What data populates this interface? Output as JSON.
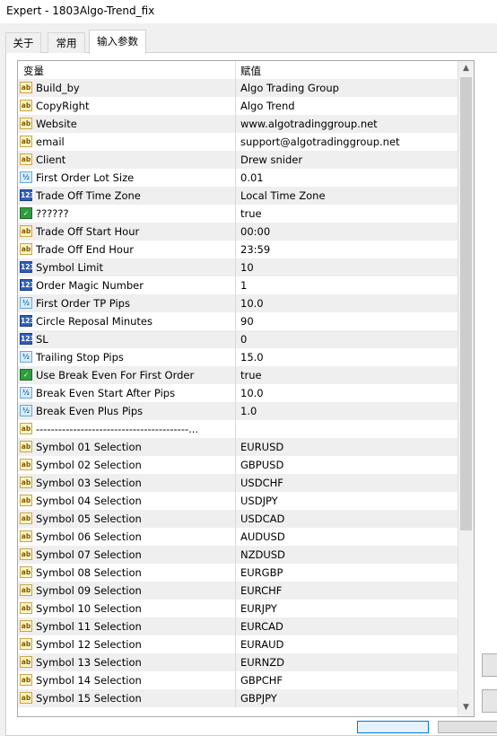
{
  "window": {
    "title": "Expert - 1803Algo-Trend_fix"
  },
  "tabs": [
    {
      "label": "关于"
    },
    {
      "label": "常用"
    },
    {
      "label": "输入参数"
    }
  ],
  "grid": {
    "headers": {
      "variable": "变量",
      "value": "赋值"
    },
    "rows": [
      {
        "type": "ab",
        "name": "Build_by",
        "value": "Algo Trading Group"
      },
      {
        "type": "ab",
        "name": "CopyRight",
        "value": "Algo Trend"
      },
      {
        "type": "ab",
        "name": "Website",
        "value": "www.algotradinggroup.net"
      },
      {
        "type": "ab",
        "name": "email",
        "value": "support@algotradinggroup.net"
      },
      {
        "type": "ab",
        "name": "Client",
        "value": "Drew snider"
      },
      {
        "type": "frac",
        "name": "First Order Lot Size",
        "value": "0.01"
      },
      {
        "type": "n123",
        "name": "Trade Off Time Zone",
        "value": "Local Time Zone"
      },
      {
        "type": "bool",
        "name": "??????",
        "value": "true"
      },
      {
        "type": "ab",
        "name": "Trade Off Start Hour",
        "value": "00:00"
      },
      {
        "type": "ab",
        "name": "Trade Off End Hour",
        "value": "23:59"
      },
      {
        "type": "n123",
        "name": "Symbol Limit",
        "value": "10"
      },
      {
        "type": "n123",
        "name": "Order Magic Number",
        "value": "1"
      },
      {
        "type": "frac",
        "name": "First Order TP Pips",
        "value": "10.0"
      },
      {
        "type": "n123",
        "name": "Circle Reposal Minutes",
        "value": "90"
      },
      {
        "type": "n123",
        "name": "SL",
        "value": "0"
      },
      {
        "type": "frac",
        "name": "Trailing Stop Pips",
        "value": "15.0"
      },
      {
        "type": "bool",
        "name": "Use Break Even For First Order",
        "value": "true"
      },
      {
        "type": "frac",
        "name": "Break Even Start After Pips",
        "value": "10.0"
      },
      {
        "type": "frac",
        "name": "Break Even Plus Pips",
        "value": "1.0"
      },
      {
        "type": "ab",
        "name": "-----------------------------------------...",
        "value": ""
      },
      {
        "type": "ab",
        "name": "Symbol 01 Selection",
        "value": "EURUSD"
      },
      {
        "type": "ab",
        "name": "Symbol 02 Selection",
        "value": "GBPUSD"
      },
      {
        "type": "ab",
        "name": "Symbol 03 Selection",
        "value": "USDCHF"
      },
      {
        "type": "ab",
        "name": "Symbol 04 Selection",
        "value": "USDJPY"
      },
      {
        "type": "ab",
        "name": "Symbol 05 Selection",
        "value": "USDCAD"
      },
      {
        "type": "ab",
        "name": "Symbol 06 Selection",
        "value": "AUDUSD"
      },
      {
        "type": "ab",
        "name": "Symbol 07 Selection",
        "value": "NZDUSD"
      },
      {
        "type": "ab",
        "name": "Symbol 08 Selection",
        "value": "EURGBP"
      },
      {
        "type": "ab",
        "name": "Symbol 09 Selection",
        "value": "EURCHF"
      },
      {
        "type": "ab",
        "name": "Symbol 10 Selection",
        "value": "EURJPY"
      },
      {
        "type": "ab",
        "name": "Symbol 11 Selection",
        "value": "EURCAD"
      },
      {
        "type": "ab",
        "name": "Symbol 12 Selection",
        "value": "EURAUD"
      },
      {
        "type": "ab",
        "name": "Symbol 13 Selection",
        "value": "EURNZD"
      },
      {
        "type": "ab",
        "name": "Symbol 14 Selection",
        "value": "GBPCHF"
      },
      {
        "type": "ab",
        "name": "Symbol 15 Selection",
        "value": "GBPJPY"
      }
    ]
  },
  "icons": {
    "ab": "ab",
    "n123": "123",
    "frac": "½",
    "bool": "✓"
  },
  "scrollbar": {
    "up": "▲",
    "down": "▼"
  }
}
